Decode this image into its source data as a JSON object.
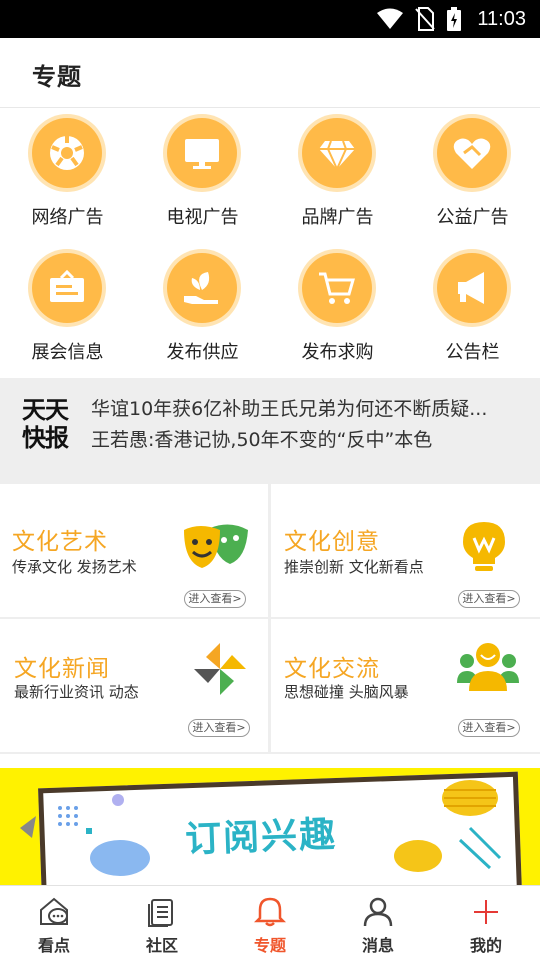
{
  "status_bar": {
    "time": "11:03"
  },
  "header": {
    "title": "专题"
  },
  "categories": [
    {
      "label": "网络广告",
      "icon": "ball-icon"
    },
    {
      "label": "电视广告",
      "icon": "tv-icon"
    },
    {
      "label": "品牌广告",
      "icon": "diamond-icon"
    },
    {
      "label": "公益广告",
      "icon": "heart-hands-icon"
    },
    {
      "label": "展会信息",
      "icon": "sign-board-icon"
    },
    {
      "label": "发布供应",
      "icon": "hand-plant-icon"
    },
    {
      "label": "发布求购",
      "icon": "cart-icon"
    },
    {
      "label": "公告栏",
      "icon": "megaphone-icon"
    }
  ],
  "news": {
    "logo_line1": "天天",
    "logo_line2": "快报",
    "headlines": [
      "华谊10年获6亿补助王氏兄弟为何还不断质疑...",
      "王若愚:香港记协,50年不变的“反中”本色"
    ]
  },
  "culture": [
    {
      "title": "文化艺术",
      "subtitle": "传承文化 发扬艺术",
      "link": "进入查看>",
      "icon": "theater-masks-icon"
    },
    {
      "title": "文化创意",
      "subtitle": "推崇创新 文化新看点",
      "link": "进入查看>",
      "icon": "lightbulb-icon"
    },
    {
      "title": "文化新闻",
      "subtitle": "最新行业资讯 动态",
      "link": "进入查看>",
      "icon": "pinwheel-icon"
    },
    {
      "title": "文化交流",
      "subtitle": "思想碰撞 头脑风暴",
      "link": "进入查看>",
      "icon": "people-group-icon"
    }
  ],
  "banner": {
    "text": "订阅兴趣"
  },
  "tabs": [
    {
      "label": "看点",
      "icon": "chat-house-icon",
      "active": false
    },
    {
      "label": "社区",
      "icon": "document-icon",
      "active": false
    },
    {
      "label": "专题",
      "icon": "bell-icon",
      "active": true
    },
    {
      "label": "消息",
      "icon": "person-icon",
      "active": false
    },
    {
      "label": "我的",
      "icon": "plus-icon",
      "active": false
    }
  ],
  "colors": {
    "accent": "#f5a623",
    "icon_bg": "#ffba48",
    "active_tab": "#f0562c",
    "banner_bg": "#fff200"
  }
}
